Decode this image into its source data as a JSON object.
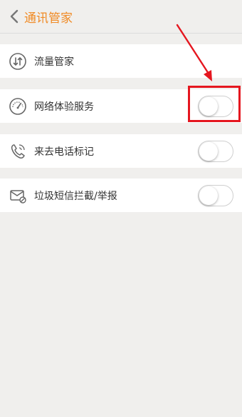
{
  "header": {
    "title": "通讯管家"
  },
  "rows": [
    {
      "label": "流量管家",
      "icon": "data-transfer-icon"
    },
    {
      "label": "网络体验服务",
      "icon": "speedometer-icon",
      "toggle_on": false
    },
    {
      "label": "来去电话标记",
      "icon": "phone-call-icon",
      "toggle_on": false
    },
    {
      "label": "垃圾短信拦截/举报",
      "icon": "spam-message-icon",
      "toggle_on": false
    }
  ],
  "colors": {
    "accent": "#f08a24",
    "annotation": "#e5161f",
    "background": "#f0efed"
  },
  "annotation": {
    "type": "red-arrow-and-box",
    "target": "网络体验服务 toggle"
  }
}
